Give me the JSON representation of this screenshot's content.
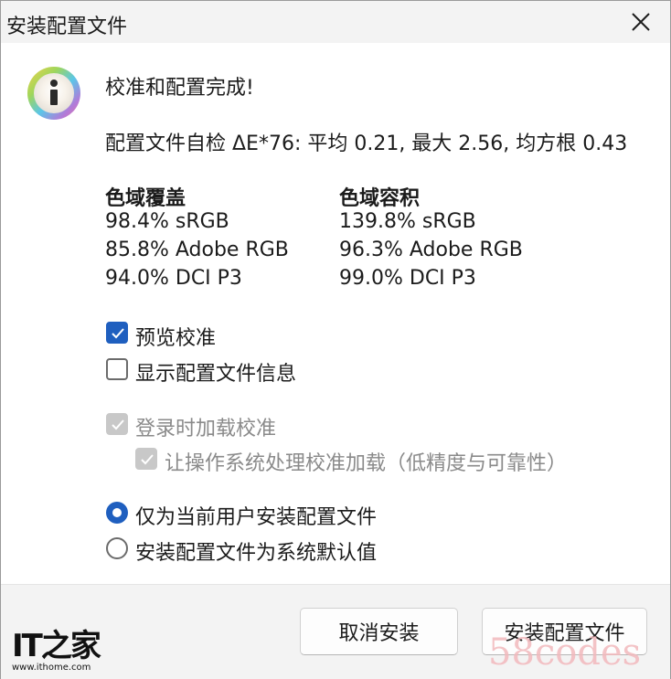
{
  "window": {
    "title": "安装配置文件"
  },
  "heading": "校准和配置完成!",
  "self_check": "配置文件自检 ΔE*76: 平均 0.21, 最大 2.56, 均方根 0.43",
  "gamut_coverage": {
    "header": "色域覆盖",
    "rows": [
      "98.4% sRGB",
      "85.8% Adobe RGB",
      "94.0% DCI P3"
    ]
  },
  "gamut_volume": {
    "header": "色域容积",
    "rows": [
      "139.8% sRGB",
      "96.3% Adobe RGB",
      "99.0% DCI P3"
    ]
  },
  "options": {
    "preview_calibration": {
      "label": "预览校准",
      "checked": true
    },
    "show_profile_info": {
      "label": "显示配置文件信息",
      "checked": false
    },
    "load_at_login": {
      "label": "登录时加载校准",
      "checked": true,
      "disabled": true
    },
    "os_handles_loading": {
      "label": "让操作系统处理校准加载（低精度与可靠性）",
      "checked": true,
      "disabled": true
    }
  },
  "install_scope": {
    "current_user": {
      "label": "仅为当前用户安装配置文件",
      "selected": true
    },
    "system_default": {
      "label": "安装配置文件为系统默认值",
      "selected": false
    }
  },
  "buttons": {
    "cancel": "取消安装",
    "install": "安装配置文件"
  },
  "branding": {
    "logo_text": "IT之家",
    "url": "www.ithome.com"
  },
  "watermark": "58codes",
  "colors": {
    "accent": "#1f5fbf",
    "disabled": "#c8c8c8",
    "footer_bg": "#f3f3f3"
  }
}
